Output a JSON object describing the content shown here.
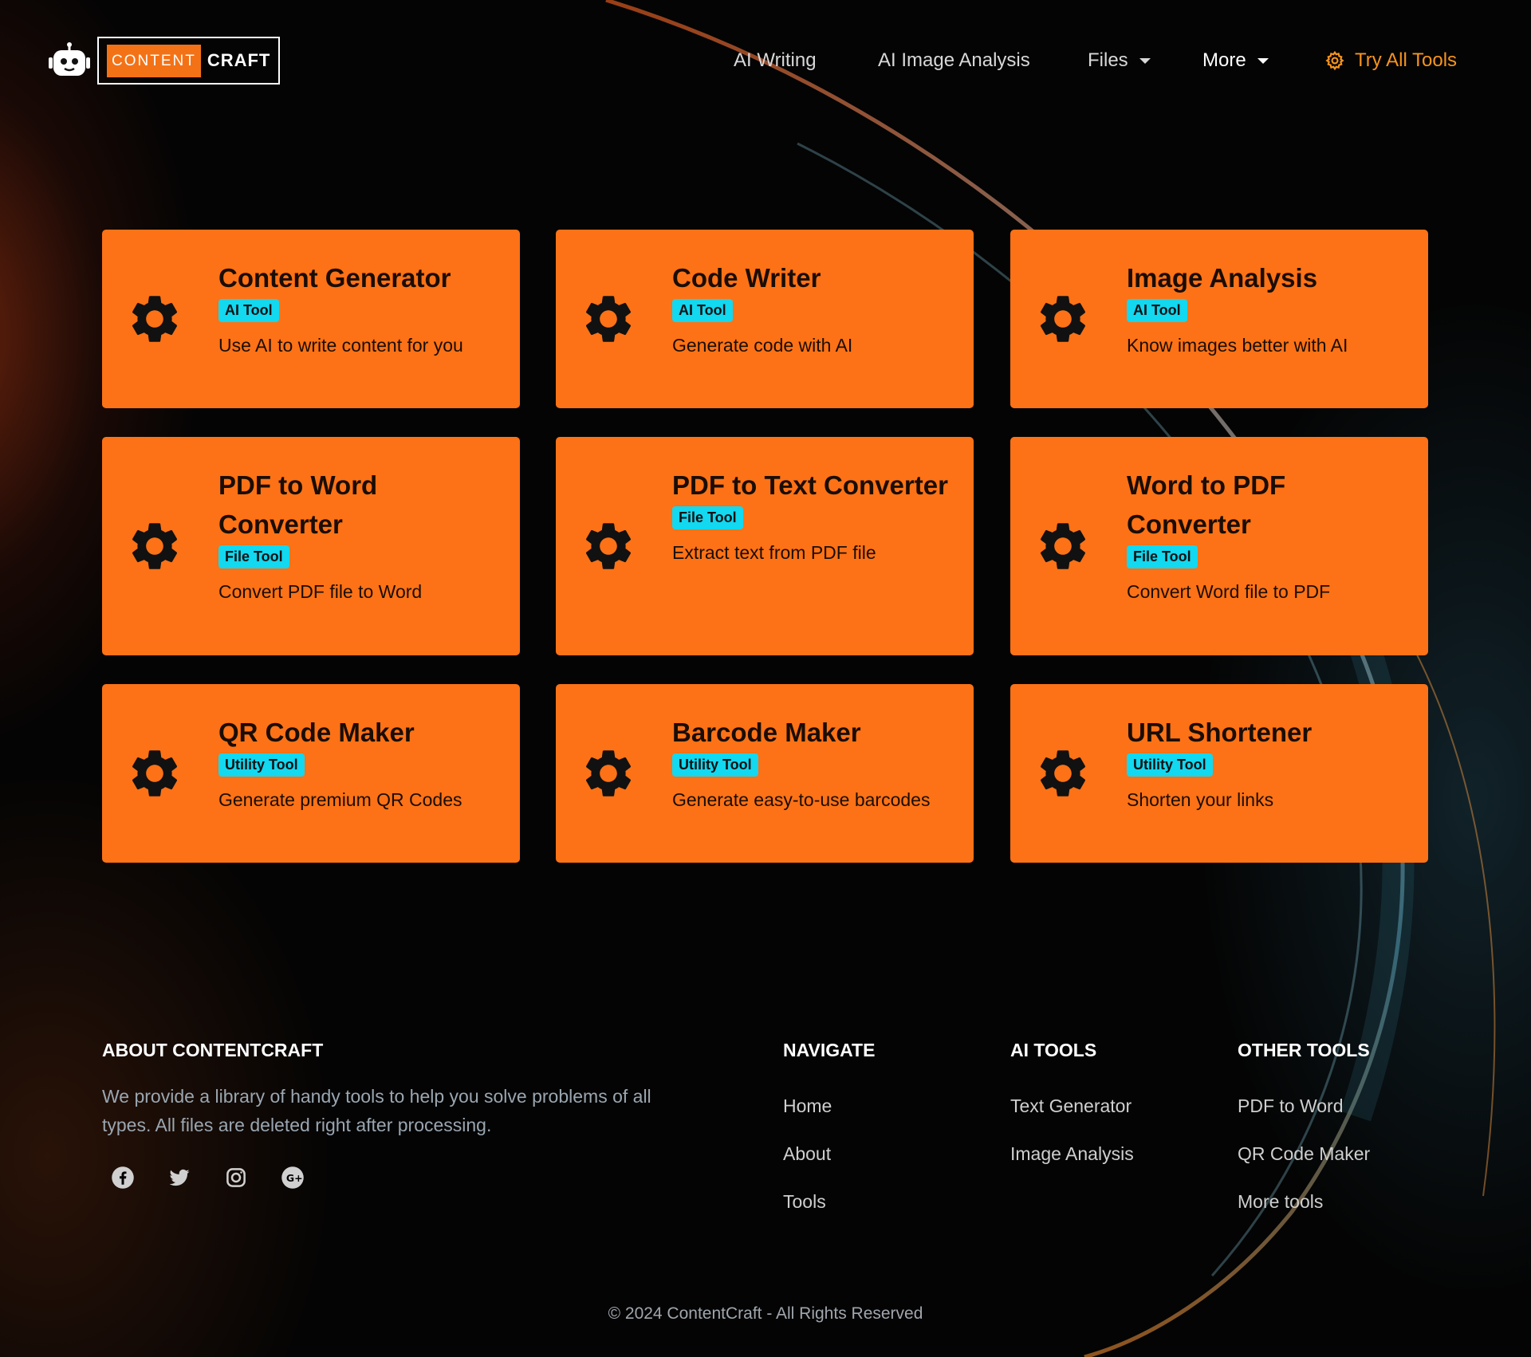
{
  "brand": {
    "content": "CONTENT",
    "craft": "CRAFT"
  },
  "nav": {
    "ai_writing": "AI Writing",
    "ai_image_analysis": "AI Image Analysis",
    "files": "Files",
    "more": "More",
    "try_all_tools": "Try All Tools"
  },
  "cards": [
    {
      "title": "Content Generator",
      "badge": "AI Tool",
      "desc": "Use AI to write content for you"
    },
    {
      "title": "Code Writer",
      "badge": "AI Tool",
      "desc": "Generate code with AI"
    },
    {
      "title": "Image Analysis",
      "badge": "AI Tool",
      "desc": "Know images better with AI"
    },
    {
      "title": "PDF to Word Converter",
      "badge": "File Tool",
      "desc": "Convert PDF file to Word"
    },
    {
      "title": "PDF to Text Converter",
      "badge": "File Tool",
      "desc": "Extract text from PDF file"
    },
    {
      "title": "Word to PDF Converter",
      "badge": "File Tool",
      "desc": "Convert Word file to PDF"
    },
    {
      "title": "QR Code Maker",
      "badge": "Utility Tool",
      "desc": "Generate premium QR Codes"
    },
    {
      "title": "Barcode Maker",
      "badge": "Utility Tool",
      "desc": "Generate easy-to-use barcodes"
    },
    {
      "title": "URL Shortener",
      "badge": "Utility Tool",
      "desc": "Shorten your links"
    }
  ],
  "footer": {
    "about_heading": "ABOUT CONTENTCRAFT",
    "about_text": "We provide a library of handy tools to help you solve problems of all types. All files are deleted right after processing.",
    "social": [
      "facebook-icon",
      "twitter-icon",
      "instagram-icon",
      "google-plus-icon"
    ],
    "navigate_heading": "NAVIGATE",
    "navigate_links": [
      "Home",
      "About",
      "Tools"
    ],
    "ai_tools_heading": "AI TOOLS",
    "ai_tools_links": [
      "Text Generator",
      "Image Analysis"
    ],
    "other_tools_heading": "OTHER TOOLS",
    "other_tools_links": [
      "PDF to Word",
      "QR Code Maker",
      "More tools"
    ],
    "copyright": "© 2024 ContentCraft - All Rights Reserved"
  },
  "colors": {
    "accent": "#fd7216",
    "badge": "#12d8f0",
    "nav_highlight": "#f7941d",
    "background": "#000000"
  }
}
